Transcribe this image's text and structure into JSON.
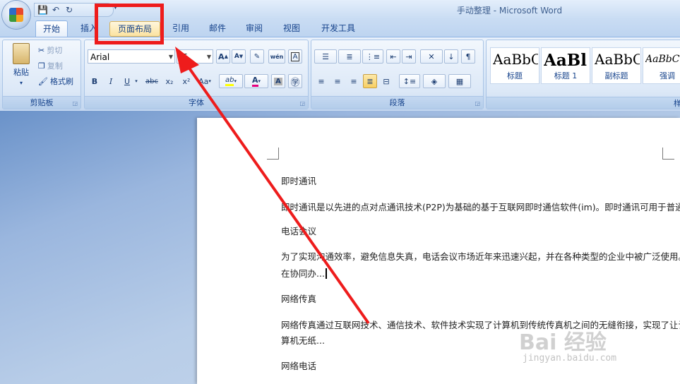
{
  "window": {
    "title": "手动整理 - Microsoft Word"
  },
  "quick_access": {
    "icons": [
      "save-icon",
      "undo-icon",
      "redo-icon"
    ]
  },
  "tabs": [
    {
      "label": "开始",
      "state": "active"
    },
    {
      "label": "插入",
      "state": "normal"
    },
    {
      "label": "页面布局",
      "state": "highlighted"
    },
    {
      "label": "引用",
      "state": "normal"
    },
    {
      "label": "邮件",
      "state": "normal"
    },
    {
      "label": "审阅",
      "state": "normal"
    },
    {
      "label": "视图",
      "state": "normal"
    },
    {
      "label": "开发工具",
      "state": "normal"
    }
  ],
  "clipboard": {
    "paste": "粘贴",
    "cut": "剪切",
    "copy": "复制",
    "format_painter": "格式刷",
    "label": "剪贴板"
  },
  "font": {
    "name": "Arial",
    "size": "五",
    "grow": "A",
    "shrink": "A",
    "phonetic": "wén",
    "border_char": "A",
    "bold": "B",
    "italic": "I",
    "underline": "U",
    "strike": "abc",
    "subscript": "x₂",
    "superscript": "x²",
    "case": "Aa",
    "highlight": "ab",
    "color": "A",
    "shade_char": "A",
    "label": "字体"
  },
  "paragraph": {
    "label": "段落"
  },
  "styles": [
    {
      "sample": "AaBbC",
      "name": "标题"
    },
    {
      "sample": "AaBl",
      "name": "标题 1"
    },
    {
      "sample": "AaBbC",
      "name": "副标题"
    },
    {
      "sample": "AaBbCcl",
      "name": "强调"
    }
  ],
  "styles_group_label_partial": "样",
  "document": {
    "paragraphs": [
      "即时通讯",
      "即时通讯是以先进的点对点通讯技术(P2P)为基础的基于互联网即时通信软件(im)。即时通讯可用于普通...",
      "电话会议",
      "为了实现沟通效率，避免信息失真，电话会议市场近年来迅速兴起，并在各种类型的企业中被广泛使用。",
      "在协同办...",
      "网络传真",
      "网络传真通过互联网技术、通信技术、软件技术实现了计算机到传统传真机之间的无缝衔接，实现了让计",
      "算机无纸...",
      "网络电话"
    ]
  },
  "watermark": {
    "brand": "Bai 经验",
    "url": "jingyan.baidu.com"
  },
  "colors": {
    "annotation_red": "#ee1c1c",
    "highlight_yellow": "#ffff00",
    "font_color_red": "#e6007e"
  }
}
